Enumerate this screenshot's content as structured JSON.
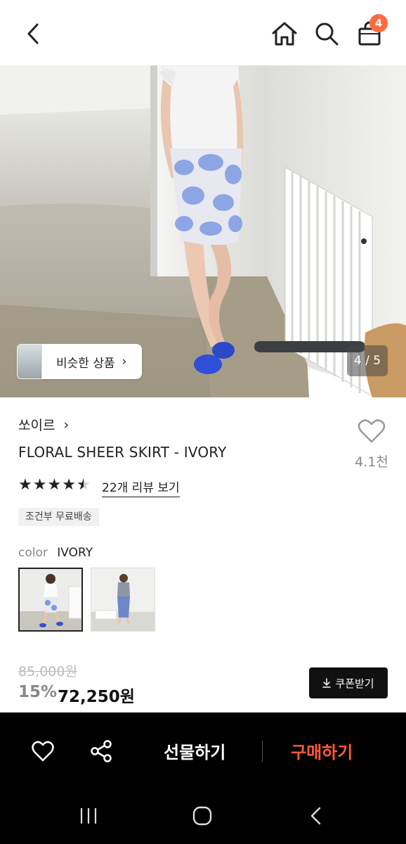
{
  "header": {
    "cart_count": "4",
    "icons": [
      "back-icon",
      "home-icon",
      "search-icon",
      "shopping-bag-icon"
    ]
  },
  "hero": {
    "similar_button_label": "비슷한 상품",
    "page_indicator": "4 / 5"
  },
  "product": {
    "brand": "쏘이르",
    "title": "FLORAL SHEER SKIRT - IVORY",
    "like_count": "4.1천",
    "rating": 4.5,
    "review_link": "22개 리뷰 보기",
    "shipping_badge": "조건부 무료배송",
    "color_label": "color",
    "color_value": "IVORY",
    "original_price": "85,000원",
    "discount_rate": "15%",
    "sale_price": "72,250원",
    "coupon_button": "쿠폰받기"
  },
  "actions": {
    "gift_label": "선물하기",
    "buy_label": "구매하기"
  },
  "colors": {
    "accent": "#ff5a36",
    "badge": "#ff6a3d",
    "action_bar": "#000000"
  }
}
